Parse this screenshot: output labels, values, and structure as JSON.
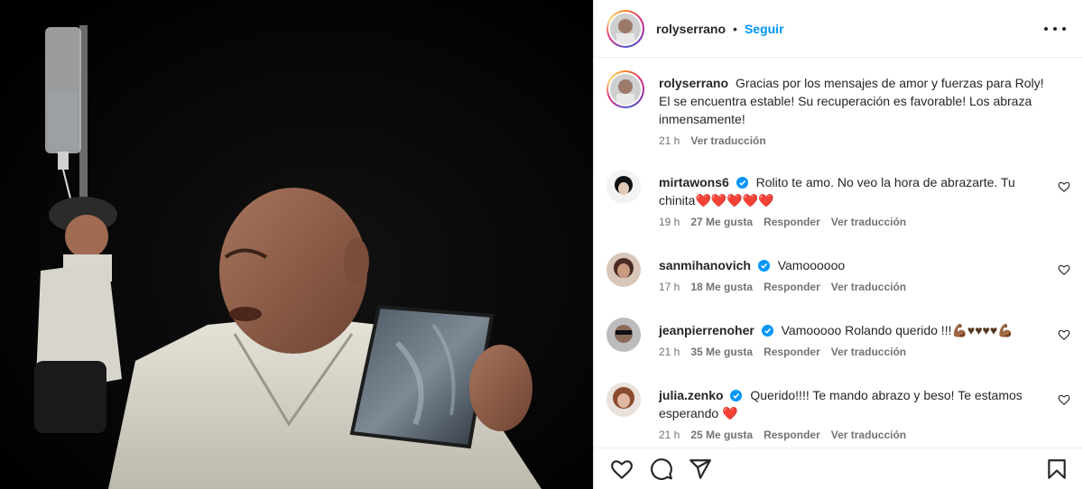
{
  "post": {
    "author": "rolyserrano",
    "separator": "•",
    "follow_label": "Seguir"
  },
  "caption": {
    "username": "rolyserrano",
    "text": "Gracias por los mensajes de amor y fuerzas para Roly! El se encuentra estable! Su recuperación es favorable! Los abraza inmensamente!",
    "time": "21 h",
    "translate_label": "Ver traducción"
  },
  "comments": [
    {
      "username": "mirtawons6",
      "verified": true,
      "text": "Rolito te amo. No veo la hora de abrazarte. Tu chinita",
      "emoji": "❤️❤️❤️❤️❤️",
      "time": "19 h",
      "likes": "27 Me gusta",
      "reply_label": "Responder",
      "translate_label": "Ver traducción"
    },
    {
      "username": "sanmihanovich",
      "verified": true,
      "text": "Vamoooooo",
      "emoji": "",
      "time": "17 h",
      "likes": "18 Me gusta",
      "reply_label": "Responder",
      "translate_label": "Ver traducción"
    },
    {
      "username": "jeanpierrenoher",
      "verified": true,
      "text": "Vamooooo Rolando querido !!!",
      "emoji": "💪🏾♥♥♥♥💪🏾",
      "time": "21 h",
      "likes": "35 Me gusta",
      "reply_label": "Responder",
      "translate_label": "Ver traducción"
    },
    {
      "username": "julia.zenko",
      "verified": true,
      "text": "Querido!!!! Te mando abrazo y beso! Te estamos esperando",
      "emoji": "❤️",
      "time": "21 h",
      "likes": "25 Me gusta",
      "reply_label": "Responder",
      "translate_label": "Ver traducción"
    }
  ],
  "actions": {
    "like_icon": "heart-icon",
    "comment_icon": "comment-icon",
    "share_icon": "share-icon",
    "save_icon": "bookmark-icon"
  },
  "colors": {
    "accent": "#0095f6",
    "text": "#262626",
    "secondary": "#737373",
    "verified": "#0095f6",
    "heart": "#ed4956"
  }
}
